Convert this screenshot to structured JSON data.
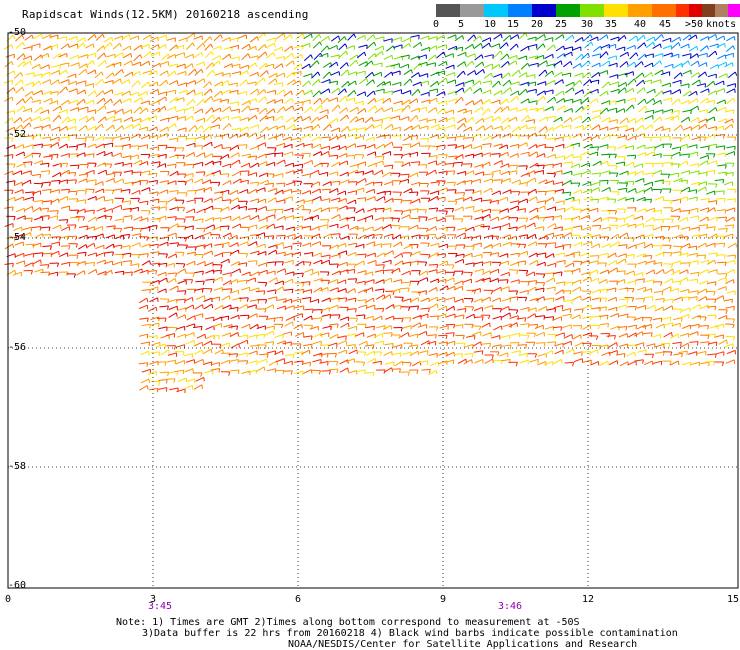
{
  "title": "Rapidscat Winds(12.5KM) 20160218 ascending",
  "legend": {
    "ticks": [
      "0",
      "5",
      "10",
      "15",
      "20",
      "25",
      "30",
      "35",
      "40",
      "45"
    ],
    "last": ">50",
    "unit": "knots",
    "colors": [
      "#555555",
      "#999999",
      "#00c8ff",
      "#0080ff",
      "#0000cc",
      "#00a000",
      "#80e000",
      "#ffe000",
      "#ffa000",
      "#ff7000",
      "#ff3000",
      "#e00000",
      "#804020",
      "#b08060",
      "#ff00ff",
      "#a000c0",
      "#4b0082"
    ]
  },
  "axes": {
    "lat_labels": [
      "-50",
      "-52",
      "-54",
      "-56",
      "-58",
      "-60"
    ],
    "lon_labels": [
      "0",
      "3",
      "6",
      "9",
      "12",
      "15"
    ]
  },
  "times": [
    "3:45",
    "3:46"
  ],
  "notes": {
    "line1": "Note: 1) Times are GMT 2)Times along bottom correspond to measurement at -50S",
    "line2": "3)Data buffer is 22 hrs from 20160218 4) Black wind barbs indicate possible contamination",
    "line3": "NOAA/NESDIS/Center for Satellite Applications and Research"
  }
}
